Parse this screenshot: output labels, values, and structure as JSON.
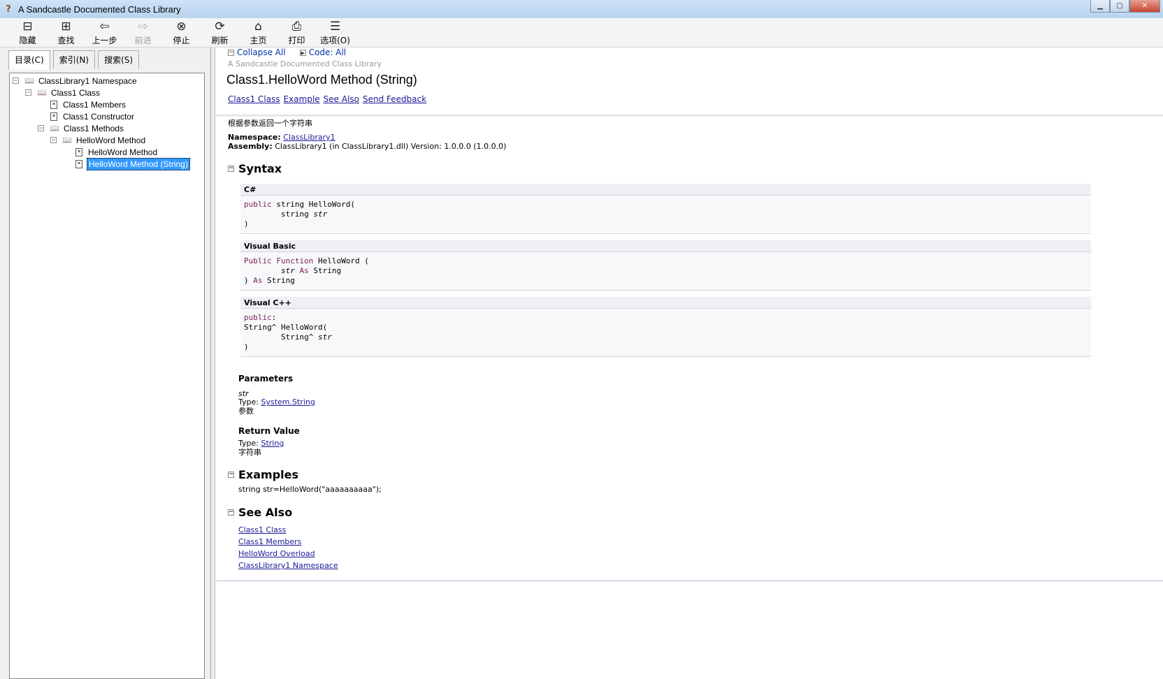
{
  "window": {
    "title": "A Sandcastle Documented Class Library",
    "app_icon": "?"
  },
  "toolbar": {
    "items": [
      {
        "label": "隐藏",
        "icon": "⊟",
        "icon_name": "hide-icon"
      },
      {
        "label": "查找",
        "icon": "⊞",
        "icon_name": "locate-icon"
      },
      {
        "label": "上一步",
        "icon": "⇦",
        "icon_name": "back-icon"
      },
      {
        "label": "前进",
        "icon": "⇨",
        "icon_name": "forward-icon"
      },
      {
        "label": "停止",
        "icon": "⊗",
        "icon_name": "stop-icon"
      },
      {
        "label": "刷新",
        "icon": "⟳",
        "icon_name": "refresh-icon"
      },
      {
        "label": "主页",
        "icon": "⌂",
        "icon_name": "home-icon"
      },
      {
        "label": "打印",
        "icon": "⎙",
        "icon_name": "print-icon"
      },
      {
        "label": "选项(O)",
        "icon": "☰",
        "icon_name": "options-icon"
      }
    ]
  },
  "left_tabs": {
    "contents": "目录(C)",
    "index": "索引(N)",
    "search": "搜索(S)"
  },
  "tree": {
    "namespace": "ClassLibrary1 Namespace",
    "class": "Class1 Class",
    "members": "Class1 Members",
    "constructor": "Class1 Constructor",
    "methods": "Class1 Methods",
    "helloword_method": "HelloWord Method",
    "helloword_method_child": "HelloWord Method",
    "helloword_method_string": "HelloWord Method (String)"
  },
  "header": {
    "collapse_all": "Collapse All",
    "code_all": "Code: All",
    "runner": "A Sandcastle Documented Class Library",
    "title": "Class1.HelloWord Method (String)",
    "links": {
      "class": "Class1 Class",
      "example": "Example",
      "see_also": "See Also",
      "feedback": "Send Feedback"
    }
  },
  "summary": "根据参数返回一个字符串",
  "info": {
    "namespace_label": "Namespace:",
    "namespace_value": "ClassLibrary1",
    "assembly_label": "Assembly:",
    "assembly_value": "ClassLibrary1 (in ClassLibrary1.dll) Version: 1.0.0.0 (1.0.0.0)"
  },
  "syntax": {
    "heading": "Syntax",
    "csharp_label": "C#",
    "vb_label": "Visual Basic",
    "cpp_label": "Visual C++",
    "cs": {
      "kw1": "public",
      "t1": " string HelloWord(",
      "t2": "        string ",
      "param": "str",
      "t3": ")"
    },
    "vb": {
      "kw1": "Public",
      "kw2": "Function",
      "t1": " HelloWord (",
      "indent": "        ",
      "param": "str",
      "kw3": "As",
      "t2": " String",
      "t3": ") ",
      "kw4": "As",
      "t4": " String"
    },
    "cpp": {
      "kw1": "public",
      "colon": ":",
      "t1": "String^ HelloWord(",
      "t2": "        String^ ",
      "param": "str",
      "t3": ")"
    }
  },
  "parameters": {
    "heading": "Parameters",
    "name": "str",
    "type_label": "Type:",
    "type_value": "System.String",
    "desc": "参数"
  },
  "return_value": {
    "heading": "Return Value",
    "type_label": "Type:",
    "type_value": "String",
    "desc": "字符串"
  },
  "examples": {
    "heading": "Examples",
    "code": "string str=HelloWord(\"aaaaaaaaaa\");"
  },
  "see_also": {
    "heading": "See Also",
    "links": [
      "Class1 Class",
      "Class1 Members",
      "HelloWord Overload",
      "ClassLibrary1 Namespace"
    ]
  }
}
